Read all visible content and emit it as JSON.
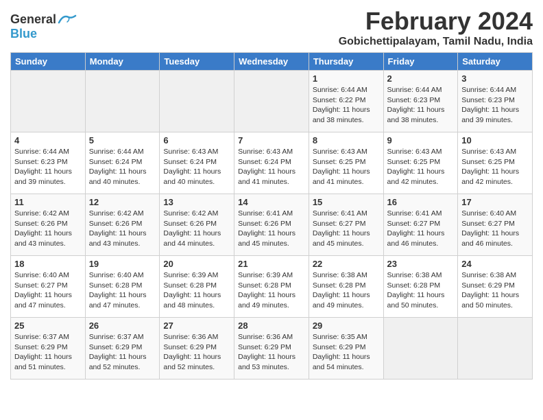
{
  "logo": {
    "general": "General",
    "blue": "Blue"
  },
  "title": "February 2024",
  "subtitle": "Gobichettipalayam, Tamil Nadu, India",
  "days_of_week": [
    "Sunday",
    "Monday",
    "Tuesday",
    "Wednesday",
    "Thursday",
    "Friday",
    "Saturday"
  ],
  "weeks": [
    [
      {
        "day": "",
        "info": ""
      },
      {
        "day": "",
        "info": ""
      },
      {
        "day": "",
        "info": ""
      },
      {
        "day": "",
        "info": ""
      },
      {
        "day": "1",
        "info": "Sunrise: 6:44 AM\nSunset: 6:22 PM\nDaylight: 11 hours\nand 38 minutes."
      },
      {
        "day": "2",
        "info": "Sunrise: 6:44 AM\nSunset: 6:23 PM\nDaylight: 11 hours\nand 38 minutes."
      },
      {
        "day": "3",
        "info": "Sunrise: 6:44 AM\nSunset: 6:23 PM\nDaylight: 11 hours\nand 39 minutes."
      }
    ],
    [
      {
        "day": "4",
        "info": "Sunrise: 6:44 AM\nSunset: 6:23 PM\nDaylight: 11 hours\nand 39 minutes."
      },
      {
        "day": "5",
        "info": "Sunrise: 6:44 AM\nSunset: 6:24 PM\nDaylight: 11 hours\nand 40 minutes."
      },
      {
        "day": "6",
        "info": "Sunrise: 6:43 AM\nSunset: 6:24 PM\nDaylight: 11 hours\nand 40 minutes."
      },
      {
        "day": "7",
        "info": "Sunrise: 6:43 AM\nSunset: 6:24 PM\nDaylight: 11 hours\nand 41 minutes."
      },
      {
        "day": "8",
        "info": "Sunrise: 6:43 AM\nSunset: 6:25 PM\nDaylight: 11 hours\nand 41 minutes."
      },
      {
        "day": "9",
        "info": "Sunrise: 6:43 AM\nSunset: 6:25 PM\nDaylight: 11 hours\nand 42 minutes."
      },
      {
        "day": "10",
        "info": "Sunrise: 6:43 AM\nSunset: 6:25 PM\nDaylight: 11 hours\nand 42 minutes."
      }
    ],
    [
      {
        "day": "11",
        "info": "Sunrise: 6:42 AM\nSunset: 6:26 PM\nDaylight: 11 hours\nand 43 minutes."
      },
      {
        "day": "12",
        "info": "Sunrise: 6:42 AM\nSunset: 6:26 PM\nDaylight: 11 hours\nand 43 minutes."
      },
      {
        "day": "13",
        "info": "Sunrise: 6:42 AM\nSunset: 6:26 PM\nDaylight: 11 hours\nand 44 minutes."
      },
      {
        "day": "14",
        "info": "Sunrise: 6:41 AM\nSunset: 6:26 PM\nDaylight: 11 hours\nand 45 minutes."
      },
      {
        "day": "15",
        "info": "Sunrise: 6:41 AM\nSunset: 6:27 PM\nDaylight: 11 hours\nand 45 minutes."
      },
      {
        "day": "16",
        "info": "Sunrise: 6:41 AM\nSunset: 6:27 PM\nDaylight: 11 hours\nand 46 minutes."
      },
      {
        "day": "17",
        "info": "Sunrise: 6:40 AM\nSunset: 6:27 PM\nDaylight: 11 hours\nand 46 minutes."
      }
    ],
    [
      {
        "day": "18",
        "info": "Sunrise: 6:40 AM\nSunset: 6:27 PM\nDaylight: 11 hours\nand 47 minutes."
      },
      {
        "day": "19",
        "info": "Sunrise: 6:40 AM\nSunset: 6:28 PM\nDaylight: 11 hours\nand 47 minutes."
      },
      {
        "day": "20",
        "info": "Sunrise: 6:39 AM\nSunset: 6:28 PM\nDaylight: 11 hours\nand 48 minutes."
      },
      {
        "day": "21",
        "info": "Sunrise: 6:39 AM\nSunset: 6:28 PM\nDaylight: 11 hours\nand 49 minutes."
      },
      {
        "day": "22",
        "info": "Sunrise: 6:38 AM\nSunset: 6:28 PM\nDaylight: 11 hours\nand 49 minutes."
      },
      {
        "day": "23",
        "info": "Sunrise: 6:38 AM\nSunset: 6:28 PM\nDaylight: 11 hours\nand 50 minutes."
      },
      {
        "day": "24",
        "info": "Sunrise: 6:38 AM\nSunset: 6:29 PM\nDaylight: 11 hours\nand 50 minutes."
      }
    ],
    [
      {
        "day": "25",
        "info": "Sunrise: 6:37 AM\nSunset: 6:29 PM\nDaylight: 11 hours\nand 51 minutes."
      },
      {
        "day": "26",
        "info": "Sunrise: 6:37 AM\nSunset: 6:29 PM\nDaylight: 11 hours\nand 52 minutes."
      },
      {
        "day": "27",
        "info": "Sunrise: 6:36 AM\nSunset: 6:29 PM\nDaylight: 11 hours\nand 52 minutes."
      },
      {
        "day": "28",
        "info": "Sunrise: 6:36 AM\nSunset: 6:29 PM\nDaylight: 11 hours\nand 53 minutes."
      },
      {
        "day": "29",
        "info": "Sunrise: 6:35 AM\nSunset: 6:29 PM\nDaylight: 11 hours\nand 54 minutes."
      },
      {
        "day": "",
        "info": ""
      },
      {
        "day": "",
        "info": ""
      }
    ]
  ]
}
